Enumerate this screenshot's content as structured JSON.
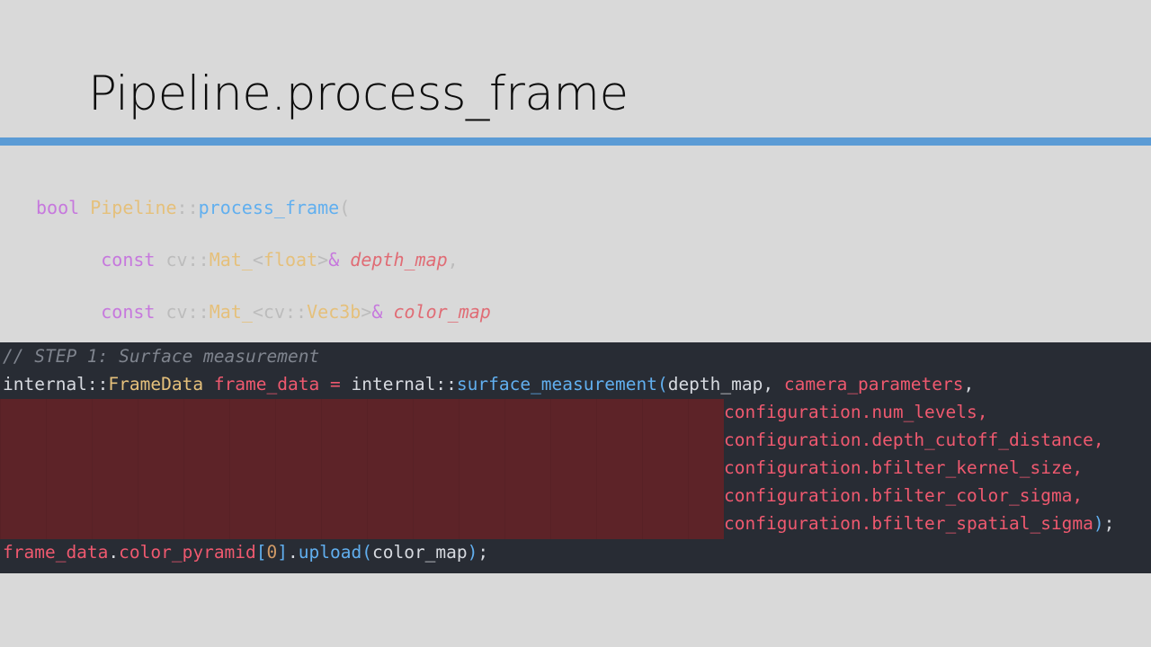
{
  "slide": {
    "title": "Pipeline.process_frame",
    "accent_color": "#5b9bd5"
  },
  "signature": {
    "l1": {
      "ret": "bool",
      "cls": "Pipeline",
      "sep": "::",
      "fn": "process_frame",
      "open": "("
    },
    "l2": {
      "kw": "const",
      "ns": "cv",
      "sep": "::",
      "tmpl": "Mat_",
      "lt": "<",
      "arg": "float",
      "gt": ">",
      "amp": "&",
      "param": "depth_map",
      "comma": ","
    },
    "l3": {
      "kw": "const",
      "ns": "cv",
      "sep": "::",
      "tmpl": "Mat_",
      "lt": "<",
      "ns2": "cv",
      "sep2": "::",
      "arg": "Vec3b",
      "gt": ">",
      "amp": "&",
      "param": "color_map"
    },
    "l4": {
      "close": ")"
    }
  },
  "code": {
    "comment": "// STEP 1: Surface measurement",
    "line1": {
      "ns": "internal",
      "sep": "::",
      "type": "FrameData",
      "var": "frame_data",
      "eq": "=",
      "ns2": "internal",
      "sep2": "::",
      "fn": "surface_measurement",
      "open": "(",
      "arg1": "depth_map",
      "comma": ",",
      "arg2": "camera_parameters",
      "comma2": ","
    },
    "args": [
      "configuration.num_levels,",
      "configuration.depth_cutoff_distance,",
      "configuration.bfilter_kernel_size,",
      "configuration.bfilter_color_sigma,"
    ],
    "last_arg": {
      "text": "configuration.bfilter_spatial_sigma",
      "close": ")",
      "semi": ";"
    },
    "line_final": {
      "obj": "frame_data",
      "dot": ".",
      "member": "color_pyramid",
      "lb": "[",
      "idx": "0",
      "rb": "]",
      "dot2": ".",
      "fn": "upload",
      "open": "(",
      "arg": "color_map",
      "close": ")",
      "semi": ";"
    }
  }
}
